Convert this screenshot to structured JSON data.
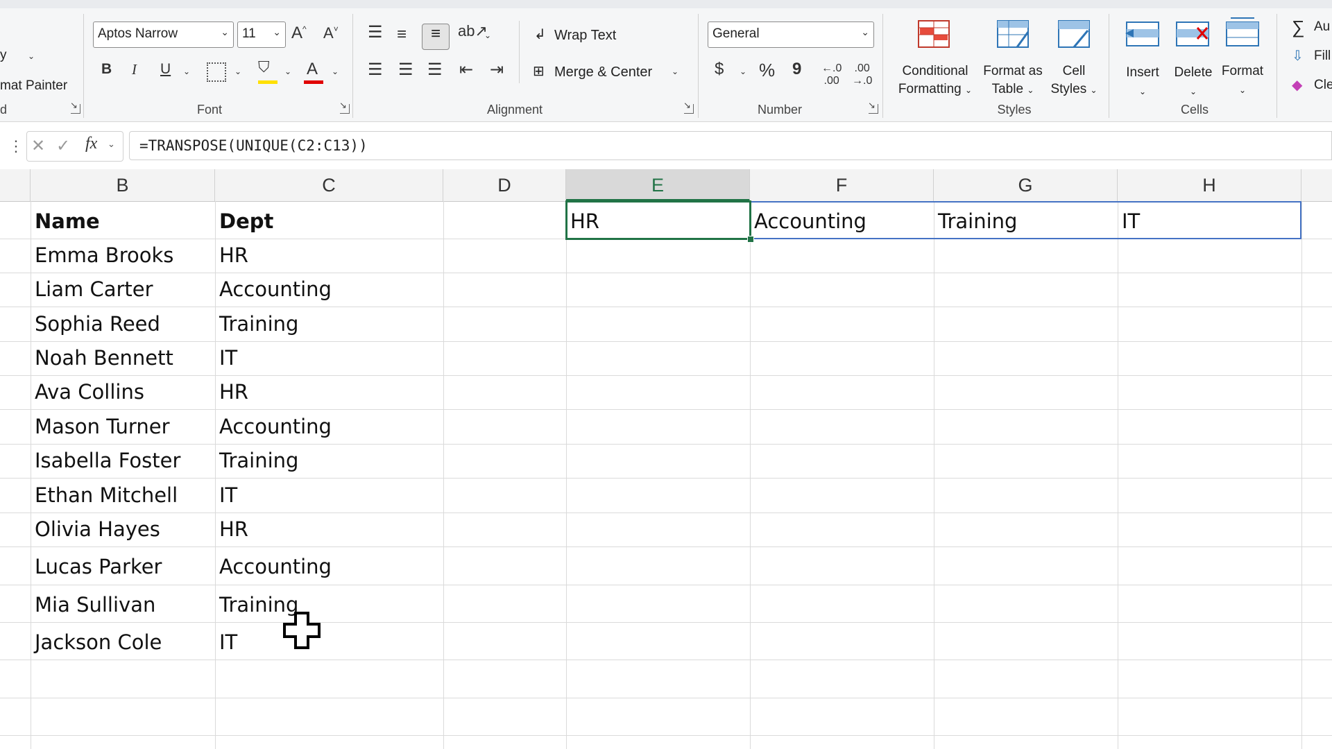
{
  "ribbon": {
    "clipboard": {
      "copy_partial": "y",
      "format_painter_partial": "mat Painter",
      "group_label_partial": "d"
    },
    "font": {
      "family": "Aptos Narrow",
      "size": "11",
      "grow_label": "A",
      "shrink_label": "A",
      "bold": "B",
      "italic": "I",
      "underline": "U",
      "font_color_label": "A",
      "group_label": "Font"
    },
    "alignment": {
      "wrap_text": "Wrap Text",
      "merge_center": "Merge & Center",
      "group_label": "Alignment"
    },
    "number": {
      "format": "General",
      "currency": "$",
      "percent": "%",
      "comma": "9",
      "group_label": "Number"
    },
    "styles": {
      "conditional_formatting_line1": "Conditional",
      "conditional_formatting_line2": "Formatting",
      "format_as_table_line1": "Format as",
      "format_as_table_line2": "Table",
      "cell_styles_line1": "Cell",
      "cell_styles_line2": "Styles",
      "group_label": "Styles"
    },
    "cells": {
      "insert": "Insert",
      "delete": "Delete",
      "format": "Format",
      "group_label": "Cells"
    },
    "editing": {
      "autosum_partial": "Au",
      "fill_partial": "Fill",
      "clear_partial": "Cle"
    }
  },
  "formula_bar": {
    "fx_label": "fx",
    "formula": "=TRANSPOSE(UNIQUE(C2:C13))"
  },
  "columns": [
    "B",
    "C",
    "D",
    "E",
    "F",
    "G",
    "H"
  ],
  "active_column": "E",
  "table": {
    "headers": [
      "Name",
      "Dept"
    ],
    "rows": [
      [
        "Emma Brooks",
        "HR"
      ],
      [
        "Liam Carter",
        "Accounting"
      ],
      [
        "Sophia Reed",
        "Training"
      ],
      [
        "Noah Bennett",
        "IT"
      ],
      [
        "Ava Collins",
        "HR"
      ],
      [
        "Mason Turner",
        "Accounting"
      ],
      [
        "Isabella Foster",
        "Training"
      ],
      [
        "Ethan Mitchell",
        "IT"
      ],
      [
        "Olivia Hayes",
        "HR"
      ],
      [
        "Lucas Parker",
        "Accounting"
      ],
      [
        "Mia Sullivan",
        "Training"
      ],
      [
        "Jackson Cole",
        "IT"
      ]
    ]
  },
  "spill_result": [
    "HR",
    "Accounting",
    "Training",
    "IT"
  ],
  "colors": {
    "selection": "#217346",
    "spill_border": "#4472c4",
    "font_color_bar": "#e00000",
    "highlight_bar": "#ffe000"
  }
}
